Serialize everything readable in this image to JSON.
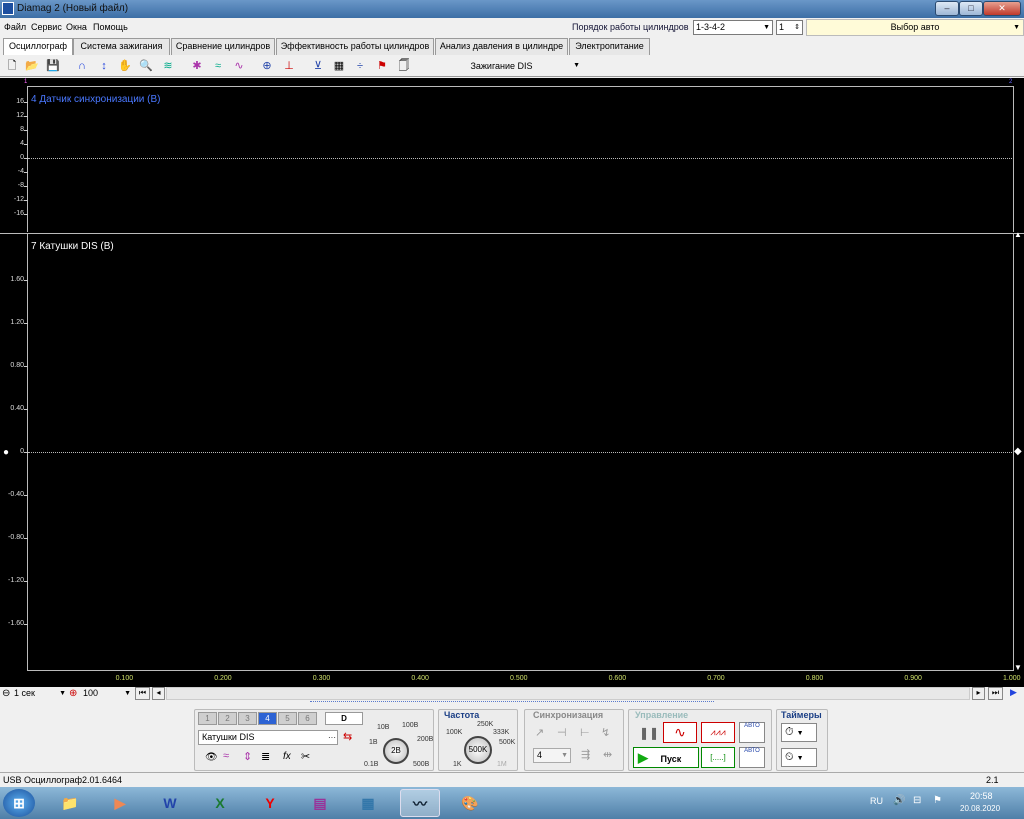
{
  "window": {
    "title": "Diamag 2 (Новый файл)",
    "minimize": "–",
    "maximize": "□",
    "close": "✕"
  },
  "menu": [
    "Файл",
    "Сервис",
    "Окна",
    "Помощь"
  ],
  "cylinders": {
    "label": "Порядок работы цилиндров",
    "order": "1-3-4-2",
    "count": "1",
    "auto": "Выбор авто"
  },
  "tabs": [
    "Осциллограф",
    "Система зажигания",
    "Сравнение цилиндров",
    "Эффективность работы цилиндров",
    "Анализ давления в цилиндре",
    "Электропитание"
  ],
  "toolbar": {
    "ignition_select": "Зажигание DIS"
  },
  "channels": {
    "top": {
      "title": "4 Датчик синхронизации (В)",
      "color": "#4a78ff",
      "ticks": [
        "16",
        "12",
        "8",
        "4",
        "0",
        "-4",
        "-8",
        "-12",
        "-16"
      ]
    },
    "bottom": {
      "title": "7 Катушки DIS (В)",
      "color": "#ffffff",
      "ticks": [
        "1.60",
        "1.20",
        "0.80",
        "0.40",
        "0",
        "-0.40",
        "-0.80",
        "-1.20",
        "-1.60"
      ]
    }
  },
  "xaxis": [
    "0.100",
    "0.200",
    "0.300",
    "0.400",
    "0.500",
    "0.600",
    "0.700",
    "0.800",
    "0.900",
    "1.000"
  ],
  "markers": {
    "left": "1",
    "right": "2"
  },
  "timebase": {
    "value": "1 сек",
    "zoom": "100"
  },
  "panel": {
    "channels": [
      "1",
      "2",
      "3",
      "4",
      "5",
      "6"
    ],
    "active_channel": "4",
    "digital": "D",
    "channel_name": "Катушки DIS",
    "voltage": {
      "value": "2В",
      "labels": [
        "10В",
        "100В",
        "1В",
        "200В",
        "0.1В",
        "500В"
      ]
    },
    "freq": {
      "title": "Частота",
      "value": "500K",
      "labels": [
        "250K",
        "100K",
        "333K",
        "500K",
        "1K",
        "1M"
      ]
    },
    "sync": {
      "title": "Синхронизация",
      "value": "4"
    },
    "control": {
      "title": "Управление",
      "start": "Пуск",
      "auto1": "АВТО",
      "auto2": "АВТО",
      "dots": "[.....]"
    },
    "timers": {
      "title": "Таймеры"
    }
  },
  "status": {
    "device": "USB Осциллограф",
    "version": "2.01.6464",
    "right": "2.1"
  },
  "taskbar": {
    "lang": "RU",
    "time": "20:58",
    "date": "20.08.2020"
  }
}
